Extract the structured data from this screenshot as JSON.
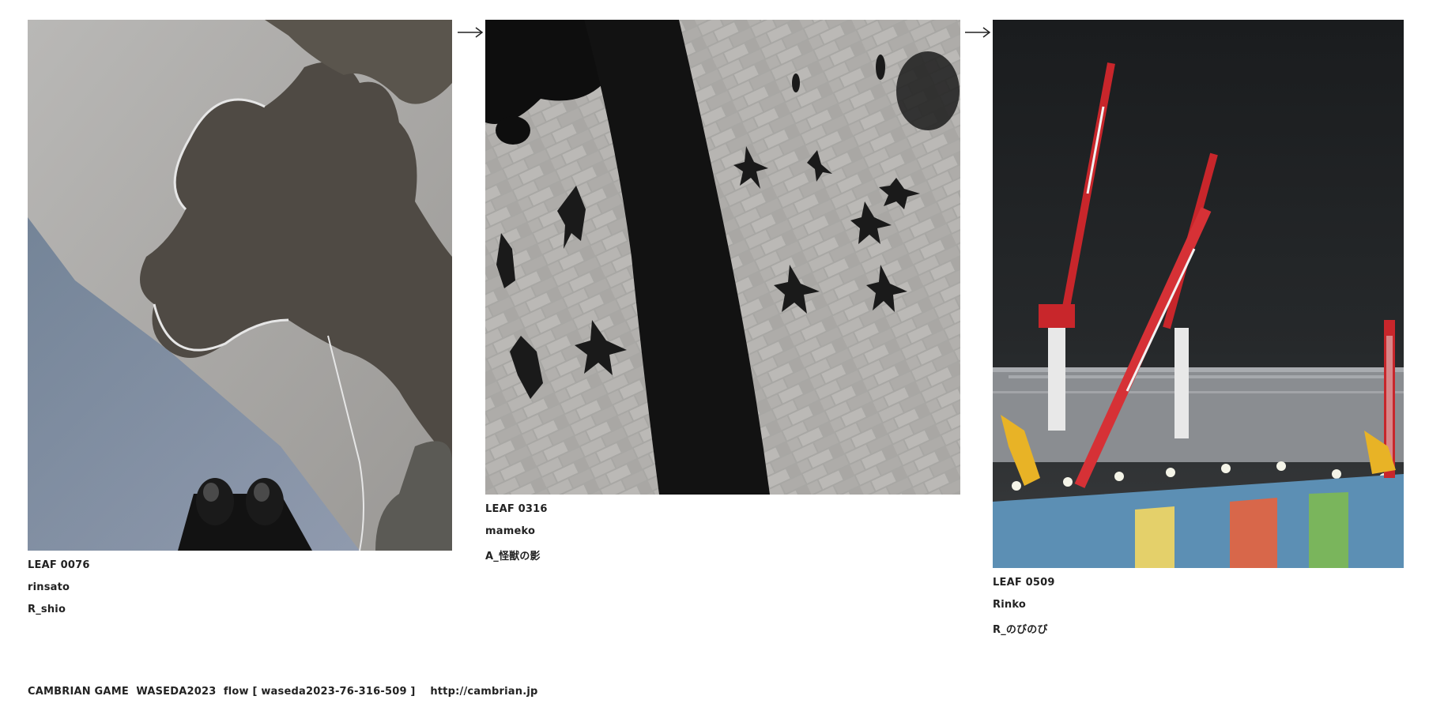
{
  "leaves": [
    {
      "leaf_id": "LEAF 0076",
      "author": "rinsato",
      "title": "R_shio",
      "image_alt": "Shadow of a puddle stain on pavement with shoes at bottom"
    },
    {
      "leaf_id": "LEAF 0316",
      "author": "mameko",
      "title": "A_怪獣の影",
      "image_alt": "Shadows of people on stone brick pavement"
    },
    {
      "leaf_id": "LEAF 0509",
      "author": "Rinko",
      "title": "R_のびのび",
      "image_alt": "Red and white construction cranes at night"
    }
  ],
  "arrows": [
    "right-arrow-icon",
    "right-arrow-icon"
  ],
  "footer": {
    "game_label": "CAMBRIAN GAME  WASEDA2023  flow [ waseda2023-76-316-509 ]",
    "link_text": "http://cambrian.jp"
  },
  "colors": {
    "text": "#222222",
    "background": "#ffffff",
    "crane_red": "#c8262b"
  }
}
